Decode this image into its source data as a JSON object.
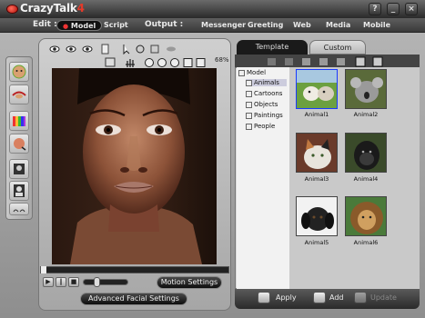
{
  "app": {
    "name": "CrazyTalk",
    "version": "4"
  },
  "window": {
    "help": "?",
    "minimize": "_",
    "close": "×"
  },
  "menubar": {
    "edit_label": "Edit :",
    "edit_tabs": [
      {
        "label": "Model"
      },
      {
        "label": "Script"
      }
    ],
    "output_label": "Output :",
    "output_tabs": [
      {
        "label": "Messenger"
      },
      {
        "label": "Greeting"
      },
      {
        "label": "Web"
      },
      {
        "label": "Media"
      },
      {
        "label": "Mobile"
      }
    ]
  },
  "viewer": {
    "zoom": "68%"
  },
  "playback": {
    "motion_settings": "Motion Settings",
    "advanced_facial_settings": "Advanced Facial Settings"
  },
  "library": {
    "tabs": [
      {
        "label": "Template"
      },
      {
        "label": "Custom"
      }
    ],
    "tree": [
      {
        "label": "Model"
      },
      {
        "label": "Animals"
      },
      {
        "label": "Cartoons"
      },
      {
        "label": "Objects"
      },
      {
        "label": "Paintings"
      },
      {
        "label": "People"
      }
    ],
    "items": [
      {
        "label": "Animal1"
      },
      {
        "label": "Animal2"
      },
      {
        "label": "Animal3"
      },
      {
        "label": "Animal4"
      },
      {
        "label": "Animal5"
      },
      {
        "label": "Animal6"
      }
    ],
    "footer": {
      "apply": "Apply",
      "add": "Add",
      "update": "Update"
    }
  }
}
